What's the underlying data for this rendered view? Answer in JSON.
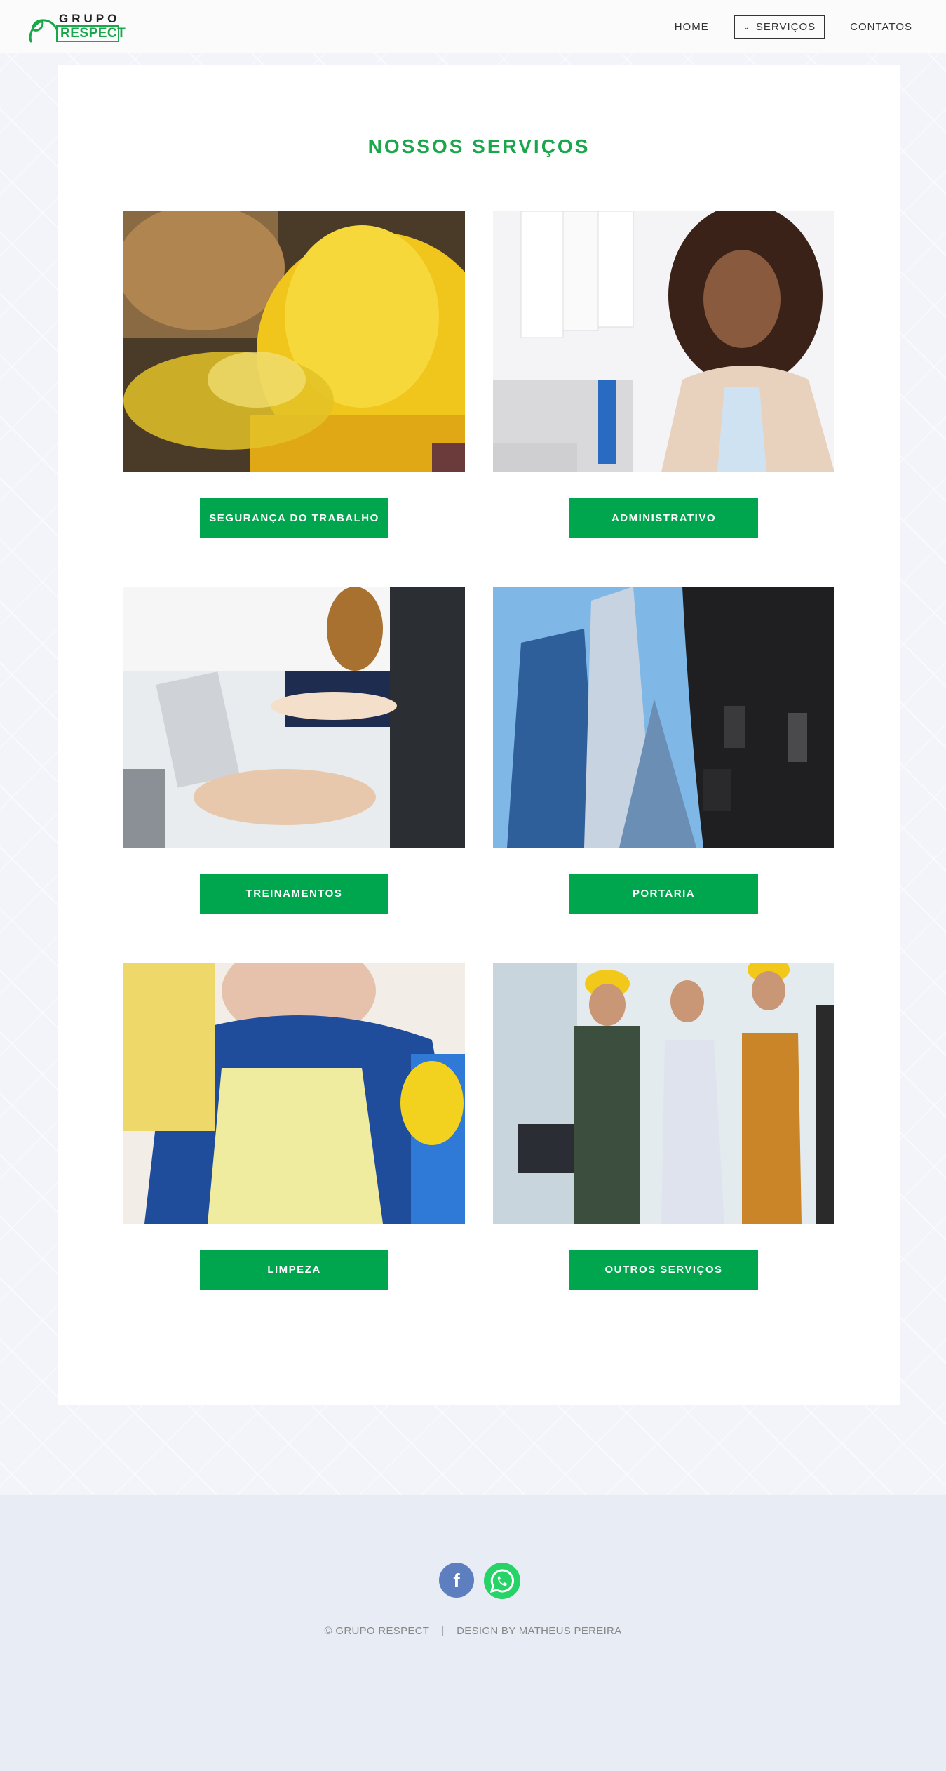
{
  "header": {
    "logo": {
      "top": "GRUPO",
      "bottom": "RESPECT"
    },
    "nav": [
      {
        "label": "HOME"
      },
      {
        "label": "SERVIÇOS",
        "active": true
      },
      {
        "label": "CONTATOS"
      }
    ]
  },
  "main": {
    "title": "NOSSOS SERVIÇOS",
    "services": [
      {
        "label": "SEGURANÇA DO TRABALHO",
        "image": "hard-hat-safety-glasses"
      },
      {
        "label": "ADMINISTRATIVO",
        "image": "office-woman"
      },
      {
        "label": "TREINAMENTOS",
        "image": "meeting-people"
      },
      {
        "label": "PORTARIA",
        "image": "security-guard-buildings"
      },
      {
        "label": "LIMPEZA",
        "image": "cleaning-worker"
      },
      {
        "label": "OUTROS SERVIÇOS",
        "image": "workers-group"
      }
    ]
  },
  "footer": {
    "copyright": "© GRUPO RESPECT",
    "credit": "DESIGN BY MATHEUS PEREIRA",
    "social": [
      "facebook-icon",
      "whatsapp-icon"
    ]
  },
  "colors": {
    "brand_green": "#00a64d",
    "title_green": "#1aa64a",
    "footer_bg": "#e8ecf4",
    "facebook": "#5d7fc0",
    "whatsapp": "#25d366"
  }
}
